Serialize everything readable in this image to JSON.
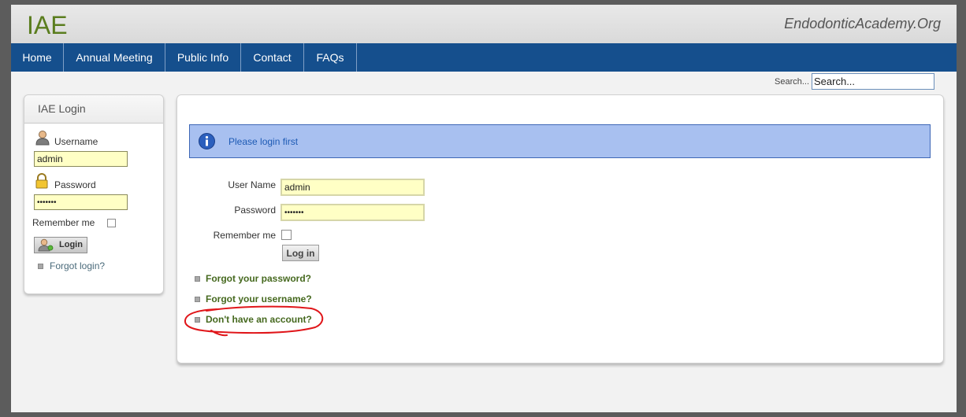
{
  "header": {
    "logo": "IAE",
    "domain": "EndodonticAcademy.Org"
  },
  "nav": {
    "items": [
      {
        "label": "Home"
      },
      {
        "label": "Annual Meeting"
      },
      {
        "label": "Public Info"
      },
      {
        "label": "Contact"
      },
      {
        "label": "FAQs"
      }
    ]
  },
  "search": {
    "label": "Search...",
    "value": "Search..."
  },
  "sidebar_login": {
    "title": "IAE Login",
    "username_label": "Username",
    "username_value": "admin",
    "password_label": "Password",
    "password_value": "•••••••",
    "remember_label": "Remember me",
    "login_button": "Login",
    "forgot_link": "Forgot login?"
  },
  "main_login": {
    "info_message": "Please login first",
    "username_label": "User Name",
    "username_value": "admin",
    "password_label": "Password",
    "password_value": "•••••••",
    "remember_label": "Remember me",
    "login_button": "Log in",
    "links": [
      {
        "label": "Forgot your password?"
      },
      {
        "label": "Forgot your username?"
      },
      {
        "label": "Don't have an account?"
      }
    ]
  },
  "colors": {
    "nav_bar": "#154f8d",
    "info_box": "#a8c0f0",
    "input_fill": "#ffffc5",
    "link_green": "#46691f",
    "annotation_red": "#e0161a"
  },
  "icons": [
    "info-icon",
    "user-icon",
    "lock-icon",
    "login-user-icon",
    "bullet-icon"
  ]
}
